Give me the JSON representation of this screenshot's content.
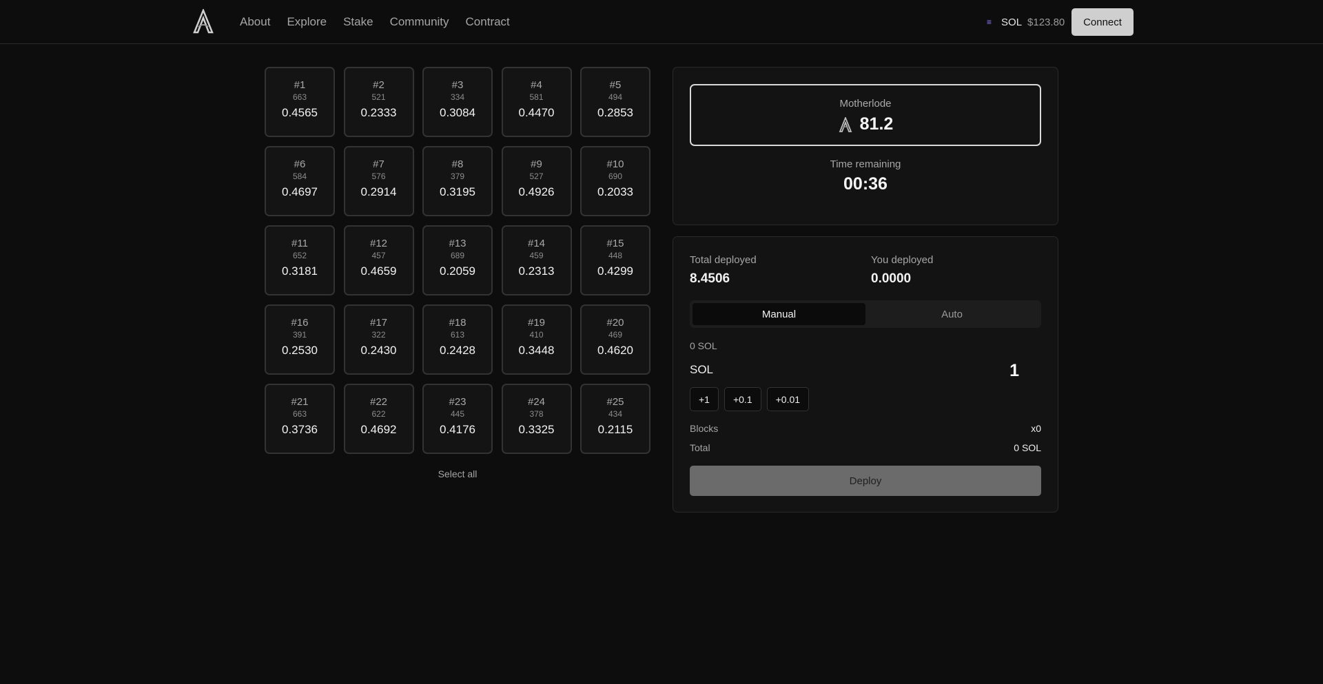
{
  "nav": {
    "items": [
      "About",
      "Explore",
      "Stake",
      "Community",
      "Contract"
    ]
  },
  "price": {
    "symbol": "SOL",
    "value": "$123.80"
  },
  "header": {
    "connect_label": "Connect"
  },
  "grid": {
    "tiles": [
      {
        "id": "#1",
        "count": "663",
        "value": "0.4565"
      },
      {
        "id": "#2",
        "count": "521",
        "value": "0.2333"
      },
      {
        "id": "#3",
        "count": "334",
        "value": "0.3084"
      },
      {
        "id": "#4",
        "count": "581",
        "value": "0.4470"
      },
      {
        "id": "#5",
        "count": "494",
        "value": "0.2853"
      },
      {
        "id": "#6",
        "count": "584",
        "value": "0.4697"
      },
      {
        "id": "#7",
        "count": "576",
        "value": "0.2914"
      },
      {
        "id": "#8",
        "count": "379",
        "value": "0.3195"
      },
      {
        "id": "#9",
        "count": "527",
        "value": "0.4926"
      },
      {
        "id": "#10",
        "count": "690",
        "value": "0.2033"
      },
      {
        "id": "#11",
        "count": "652",
        "value": "0.3181"
      },
      {
        "id": "#12",
        "count": "457",
        "value": "0.4659"
      },
      {
        "id": "#13",
        "count": "689",
        "value": "0.2059"
      },
      {
        "id": "#14",
        "count": "459",
        "value": "0.2313"
      },
      {
        "id": "#15",
        "count": "448",
        "value": "0.4299"
      },
      {
        "id": "#16",
        "count": "391",
        "value": "0.2530"
      },
      {
        "id": "#17",
        "count": "322",
        "value": "0.2430"
      },
      {
        "id": "#18",
        "count": "613",
        "value": "0.2428"
      },
      {
        "id": "#19",
        "count": "410",
        "value": "0.3448"
      },
      {
        "id": "#20",
        "count": "469",
        "value": "0.4620"
      },
      {
        "id": "#21",
        "count": "663",
        "value": "0.3736"
      },
      {
        "id": "#22",
        "count": "622",
        "value": "0.4692"
      },
      {
        "id": "#23",
        "count": "445",
        "value": "0.4176"
      },
      {
        "id": "#24",
        "count": "378",
        "value": "0.3325"
      },
      {
        "id": "#25",
        "count": "434",
        "value": "0.2115"
      }
    ],
    "select_all_label": "Select all"
  },
  "motherlode": {
    "label": "Motherlode",
    "value": "81.2"
  },
  "timer": {
    "label": "Time remaining",
    "value": "00:36"
  },
  "stats": {
    "total_label": "Total deployed",
    "total_value": "8.4506",
    "you_label": "You deployed",
    "you_value": "0.0000"
  },
  "tabs": {
    "manual": "Manual",
    "auto": "Auto"
  },
  "amount": {
    "balance": "0 SOL",
    "unit": "SOL",
    "value": "1",
    "chips": [
      "+1",
      "+0.1",
      "+0.01"
    ]
  },
  "summary": {
    "blocks_label": "Blocks",
    "blocks_value": "x0",
    "total_label": "Total",
    "total_value": "0 SOL"
  },
  "deploy_label": "Deploy"
}
